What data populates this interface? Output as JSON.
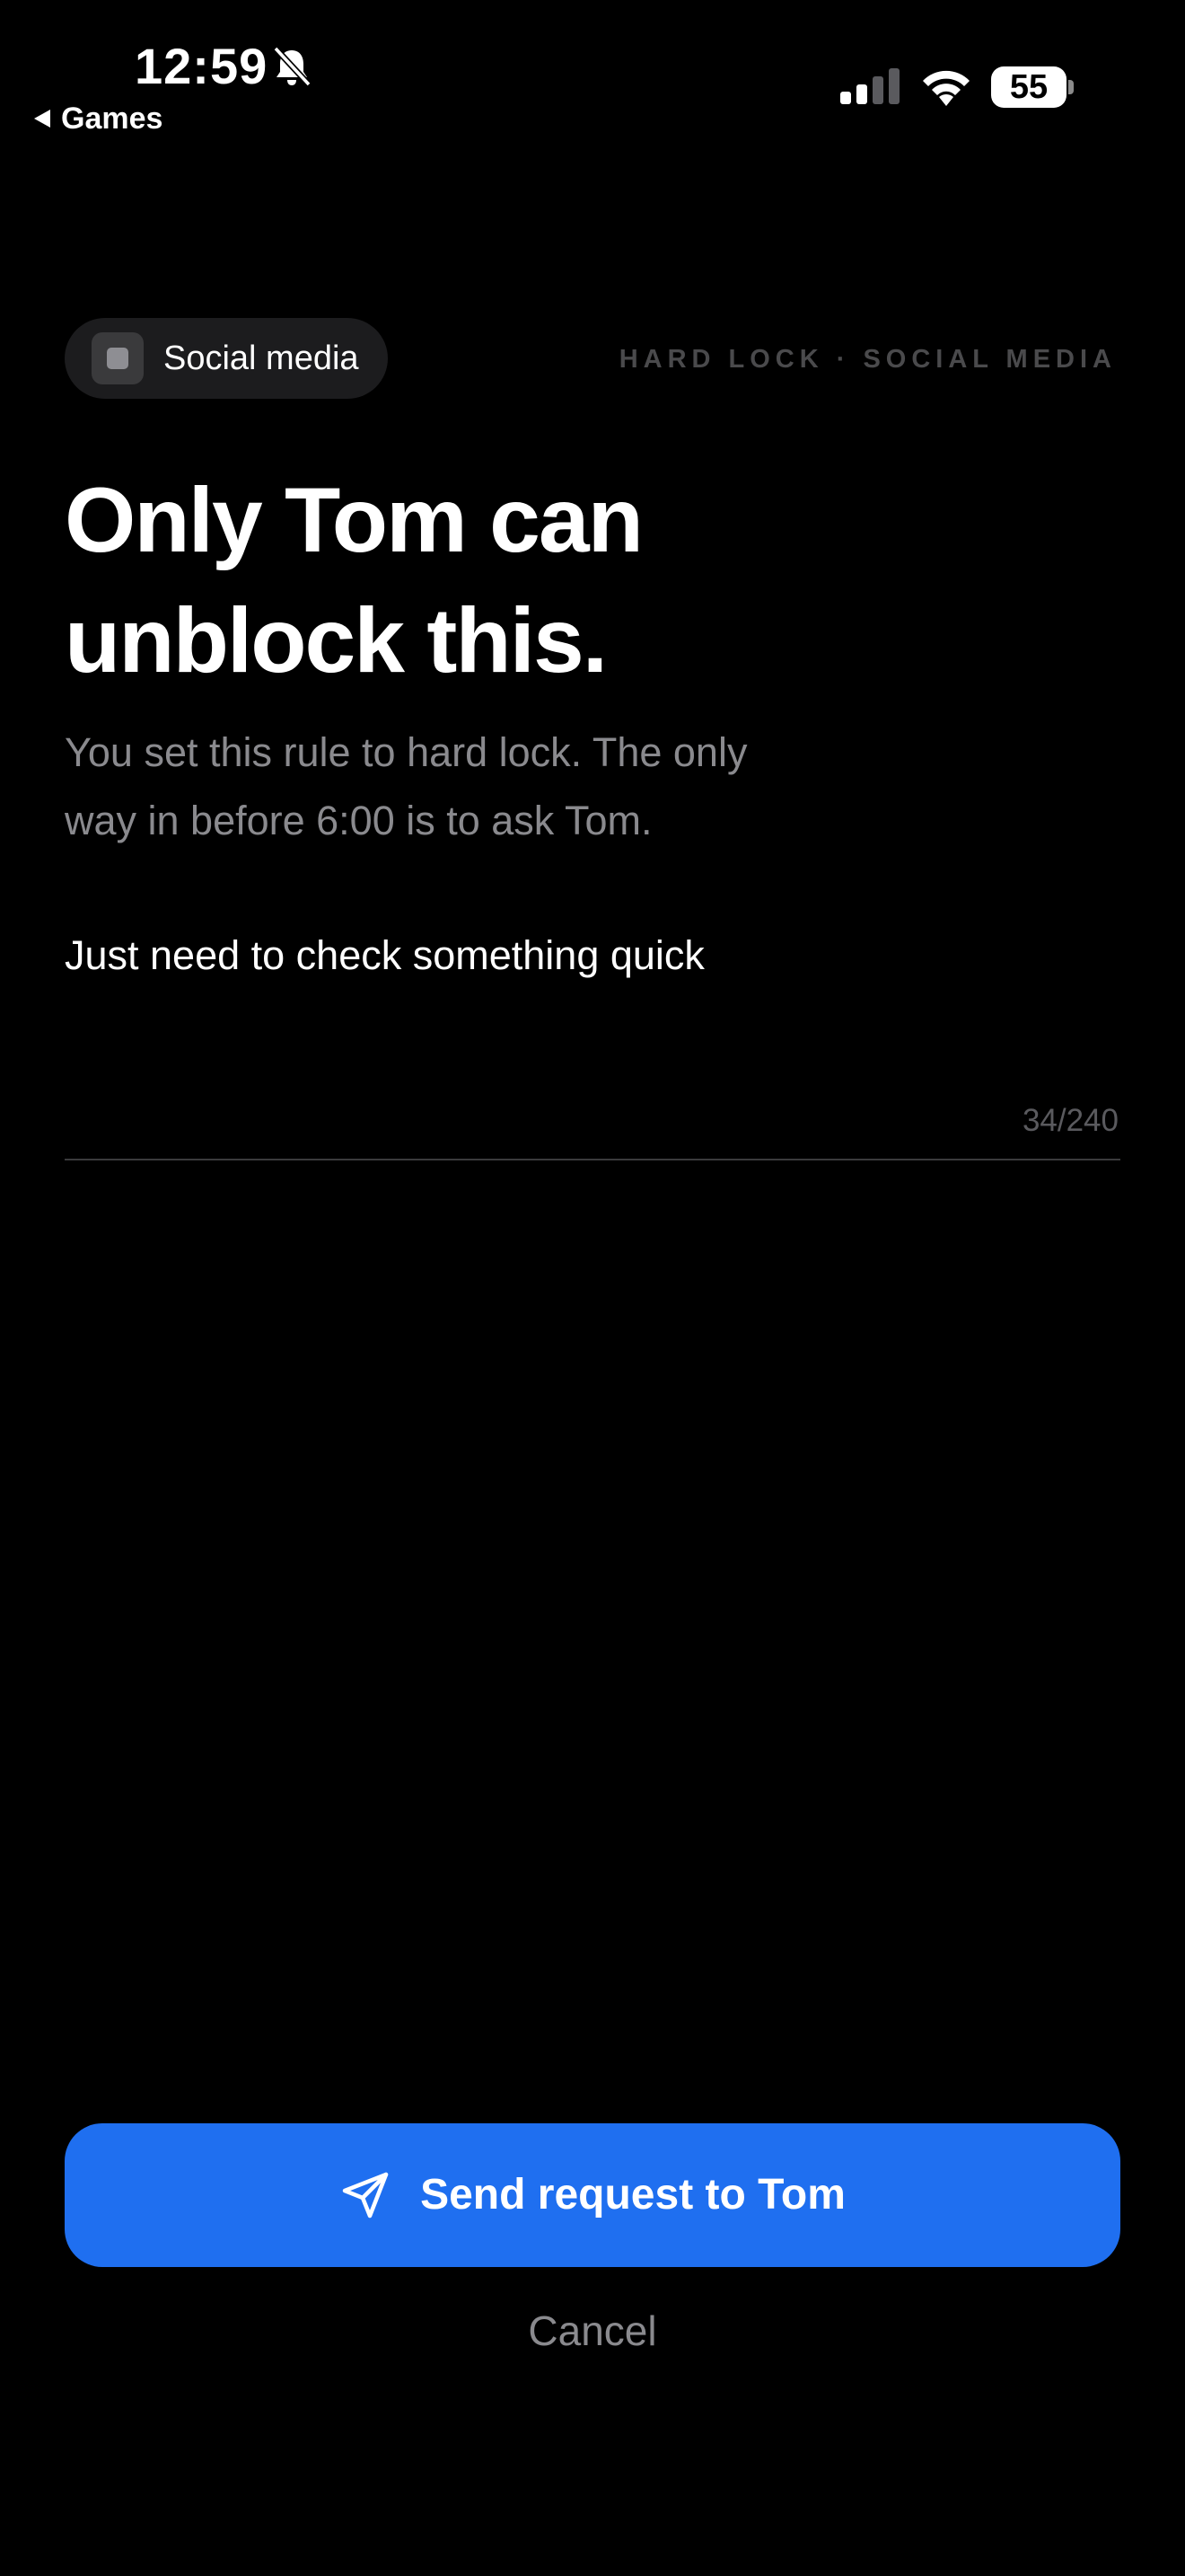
{
  "status_bar": {
    "time": "12:59",
    "back_label": "Games",
    "battery": "55",
    "icons": [
      "bell-slash-icon",
      "signal-icon",
      "wifi-icon",
      "battery-icon"
    ]
  },
  "chip": {
    "label": "Social media",
    "icon": "app-square-icon"
  },
  "caption": "HARD LOCK · SOCIAL MEDIA",
  "headline": {
    "line1": "Only Tom can",
    "line2": "unblock this."
  },
  "subtext": {
    "line1": "You set this rule to hard lock. The only",
    "line2": "way in before 6:00 is to ask Tom."
  },
  "message": {
    "value": "Just need to check something quick",
    "counter": "34/240"
  },
  "actions": {
    "send_label": "Send request to Tom",
    "send_icon": "paper-plane-icon",
    "cancel_label": "Cancel"
  },
  "colors": {
    "background": "#000000",
    "accent": "#1f6ff0",
    "secondary_text": "#8a8a8e",
    "caption_text": "#4a4a4c",
    "chip_background": "#1c1c1e"
  }
}
